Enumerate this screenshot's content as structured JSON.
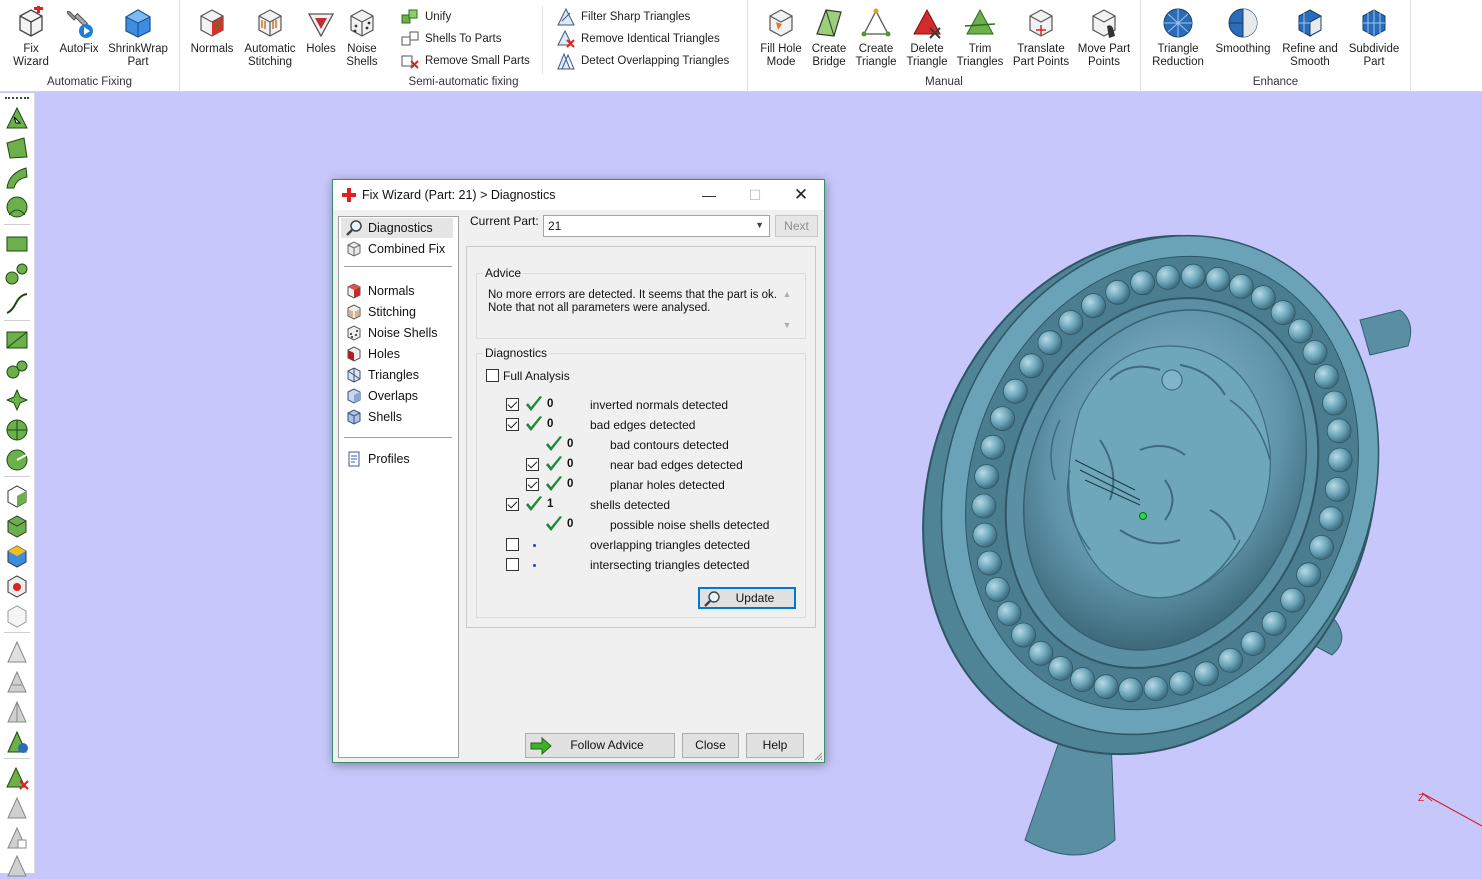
{
  "ribbon": {
    "groups": {
      "automatic": {
        "label": "Automatic Fixing"
      },
      "semiauto": {
        "label": "Semi-automatic fixing"
      },
      "manual": {
        "label": "Manual"
      },
      "enhance": {
        "label": "Enhance"
      }
    },
    "automatic_buttons": [
      {
        "label": "Fix Wizard",
        "icon": "fix-wizard-icon"
      },
      {
        "label": "AutoFix",
        "icon": "autofix-icon"
      },
      {
        "label": "ShrinkWrap Part",
        "icon": "shrinkwrap-icon"
      }
    ],
    "semiauto_buttons": [
      {
        "label": "Normals",
        "icon": "normals-icon"
      },
      {
        "label": "Automatic Stitching",
        "icon": "stitching-icon"
      },
      {
        "label": "Holes",
        "icon": "holes-icon"
      },
      {
        "label": "Noise Shells",
        "icon": "noise-shells-icon"
      }
    ],
    "semiauto_small": [
      {
        "label": "Unify",
        "icon": "unify-icon"
      },
      {
        "label": "Shells To Parts",
        "icon": "shells-to-parts-icon"
      },
      {
        "label": "Remove Small Parts",
        "icon": "remove-small-parts-icon"
      }
    ],
    "triangle_small": [
      {
        "label": "Filter Sharp Triangles",
        "icon": "filter-sharp-icon"
      },
      {
        "label": "Remove Identical Triangles",
        "icon": "remove-identical-icon"
      },
      {
        "label": "Detect Overlapping Triangles",
        "icon": "detect-overlapping-icon"
      }
    ],
    "manual_buttons": [
      {
        "label": "Fill Hole Mode",
        "icon": "fill-hole-icon"
      },
      {
        "label": "Create Bridge",
        "icon": "create-bridge-icon"
      },
      {
        "label": "Create Triangle",
        "icon": "create-triangle-icon"
      },
      {
        "label": "Delete Triangle",
        "icon": "delete-triangle-icon"
      },
      {
        "label": "Trim Triangles",
        "icon": "trim-triangles-icon"
      },
      {
        "label": "Translate Part Points",
        "icon": "translate-points-icon"
      },
      {
        "label": "Move Part Points",
        "icon": "move-points-icon"
      }
    ],
    "enhance_buttons": [
      {
        "label": "Triangle Reduction",
        "icon": "triangle-reduction-icon"
      },
      {
        "label": "Smoothing",
        "icon": "smoothing-icon"
      },
      {
        "label": "Refine and Smooth",
        "icon": "refine-smooth-icon"
      },
      {
        "label": "Subdivide Part",
        "icon": "subdivide-icon"
      }
    ]
  },
  "dialog": {
    "title": "Fix Wizard (Part: 21) > Diagnostics",
    "nav": [
      {
        "label": "Diagnostics",
        "icon": "magnifier-icon",
        "selected": true
      },
      {
        "label": "Combined Fix",
        "icon": "combined-fix-icon"
      },
      {
        "label": "Normals",
        "icon": "normals-icon"
      },
      {
        "label": "Stitching",
        "icon": "stitching-icon"
      },
      {
        "label": "Noise Shells",
        "icon": "noise-shells-icon"
      },
      {
        "label": "Holes",
        "icon": "holes-icon"
      },
      {
        "label": "Triangles",
        "icon": "triangles-icon"
      },
      {
        "label": "Overlaps",
        "icon": "overlaps-icon"
      },
      {
        "label": "Shells",
        "icon": "shells-icon"
      },
      {
        "label": "Profiles",
        "icon": "profiles-icon"
      }
    ],
    "current_part_label": "Current Part:",
    "current_part_value": "21",
    "next_label": "Next",
    "advice_legend": "Advice",
    "advice_text": "No more errors are detected. It seems that the part is ok. Note that not all parameters were analysed.",
    "diagnostics_legend": "Diagnostics",
    "full_analysis_label": "Full Analysis",
    "full_analysis_checked": false,
    "rows": [
      {
        "checkbox": true,
        "checked": true,
        "ok": true,
        "count": "0",
        "text": "inverted normals detected",
        "indent": 0
      },
      {
        "checkbox": true,
        "checked": true,
        "ok": true,
        "count": "0",
        "text": "bad edges detected",
        "indent": 0
      },
      {
        "checkbox": false,
        "checked": false,
        "ok": true,
        "count": "0",
        "text": "bad contours detected",
        "indent": 1
      },
      {
        "checkbox": true,
        "checked": true,
        "ok": true,
        "count": "0",
        "text": "near bad edges detected",
        "indent": 1
      },
      {
        "checkbox": true,
        "checked": true,
        "ok": true,
        "count": "0",
        "text": "planar holes detected",
        "indent": 1
      },
      {
        "checkbox": true,
        "checked": true,
        "ok": true,
        "count": "1",
        "text": "shells detected",
        "indent": 0
      },
      {
        "checkbox": false,
        "checked": false,
        "ok": true,
        "count": "0",
        "text": "possible noise shells detected",
        "indent": 1
      },
      {
        "checkbox": true,
        "checked": false,
        "ok": false,
        "count": "",
        "text": "overlapping triangles detected",
        "indent": 0
      },
      {
        "checkbox": true,
        "checked": false,
        "ok": false,
        "count": "",
        "text": "intersecting triangles detected",
        "indent": 0
      }
    ],
    "update_label": "Update",
    "follow_advice_label": "Follow Advice",
    "close_label": "Close",
    "help_label": "Help"
  },
  "viewport": {
    "axis_label": "Z",
    "background": "#c7c7fb",
    "model_color": "#5f93a8"
  }
}
